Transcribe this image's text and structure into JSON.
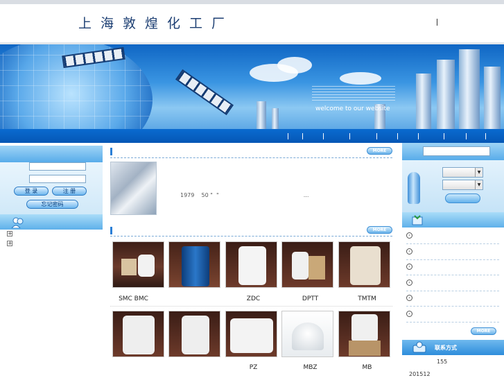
{
  "header": {
    "site_title": "上海敦煌化工厂"
  },
  "banner": {
    "welcome_text": "welcome to our website"
  },
  "login": {
    "login_label": "登 录",
    "register_label": "注 册",
    "forgot_label": "忘记密码"
  },
  "about": {
    "text": "1979    50 \"  \"                                                ...",
    "more_label": "MORE"
  },
  "products": {
    "more_label": "MORE",
    "items": [
      {
        "label": "SMC BMC"
      },
      {
        "label": ""
      },
      {
        "label": "ZDC"
      },
      {
        "label": "DPTT"
      },
      {
        "label": "TMTM"
      },
      {
        "label": ""
      },
      {
        "label": ""
      },
      {
        "label": "PZ"
      },
      {
        "label": "MBZ"
      },
      {
        "label": "MB"
      }
    ]
  },
  "tree": {
    "items": [
      {
        "label": "+"
      },
      {
        "label": "+"
      }
    ]
  },
  "news": {
    "more_label": "MORE",
    "bullet_glyph": "›"
  },
  "contact": {
    "title": "联系方式",
    "line1": "155",
    "line2": "201512"
  },
  "colors": {
    "nav_blue": "#0a6bd0",
    "title_blue": "#1d3f73",
    "panel_light": "#e9f5fd"
  }
}
